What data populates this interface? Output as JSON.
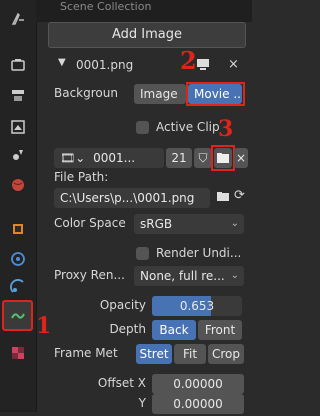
{
  "top_strip": {
    "text": "Scene Collection"
  },
  "header": {
    "title": "Add Image"
  },
  "image_row": {
    "name": "0001.png"
  },
  "background_row": {
    "label": "Backgroun",
    "image_btn": "Image",
    "movie_btn": "Movie ..."
  },
  "active_clip": {
    "label": "Active Clip"
  },
  "image_selector": {
    "name": "0001...",
    "users": "21"
  },
  "file_path": {
    "label": "File Path:",
    "value": "C:\\Users\\p...\\0001.png"
  },
  "color_space": {
    "label": "Color Space",
    "value": "sRGB"
  },
  "render_undistorted": {
    "label": "Render Undi..."
  },
  "proxy_render": {
    "label": "Proxy Ren...",
    "value": "None, full re..."
  },
  "opacity": {
    "label": "Opacity",
    "value": "0.653",
    "fraction": 0.653
  },
  "depth": {
    "label": "Depth",
    "back": "Back",
    "front": "Front"
  },
  "frame_method": {
    "label": "Frame Met",
    "stretch": "Stret",
    "fit": "Fit",
    "crop": "Crop"
  },
  "offset_x": {
    "label": "Offset X",
    "value": "0.00000"
  },
  "offset_y": {
    "label": "Y",
    "value": "0.00000"
  },
  "annotations": {
    "one": "1",
    "two": "2",
    "three": "3"
  },
  "colors": {
    "accent": "#4772b3",
    "annotation": "#e0241a",
    "panel": "#2b2b2b"
  }
}
